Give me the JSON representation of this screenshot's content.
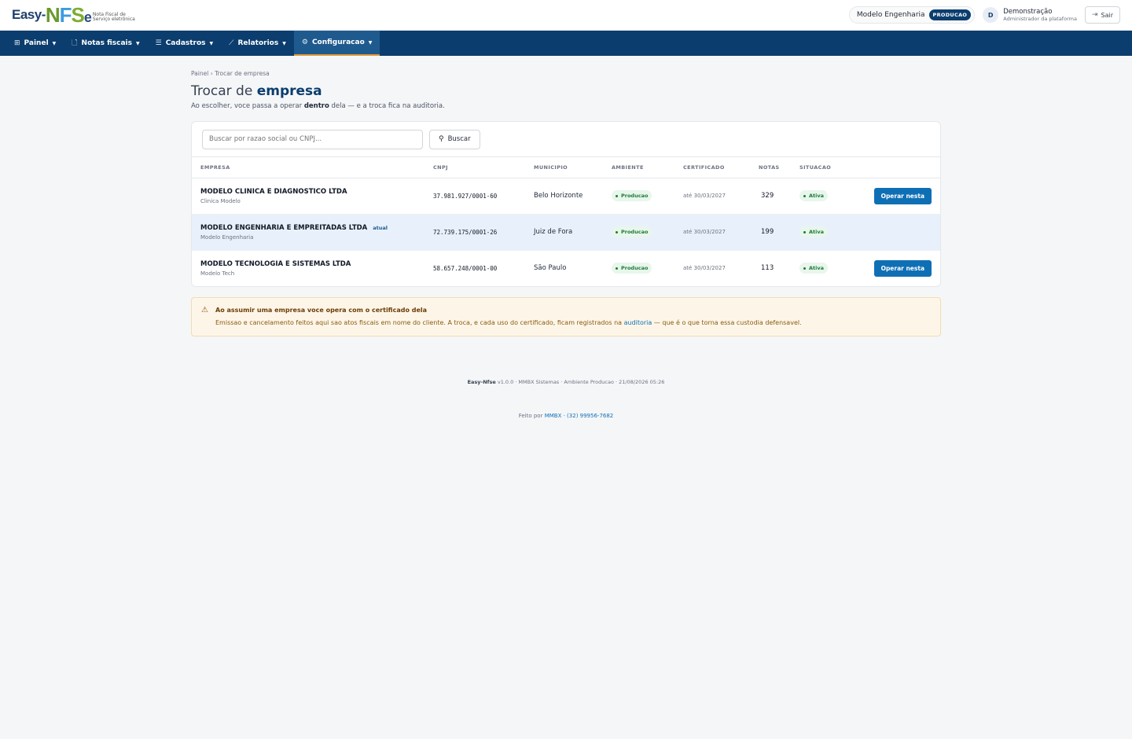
{
  "header": {
    "logo": {
      "easy": "Easy-",
      "n": "N",
      "f": "F",
      "s": "S",
      "e": "e",
      "subtitle": "Nota Fiscal de Serviço eletrônica"
    },
    "company": "Modelo Engenharia",
    "environment_badge": "PRODUCAO",
    "user_initial": "D",
    "user_name": "Demonstração",
    "user_role": "Administrador da plataforma",
    "logout_label": "Sair"
  },
  "nav": [
    {
      "label": "Painel",
      "icon": "dashboard-icon"
    },
    {
      "label": "Notas fiscais",
      "icon": "document-icon"
    },
    {
      "label": "Cadastros",
      "icon": "list-icon"
    },
    {
      "label": "Relatorios",
      "icon": "chart-icon"
    },
    {
      "label": "Configuracao",
      "icon": "gear-icon",
      "active": true
    }
  ],
  "breadcrumb": "Painel › Trocar de empresa",
  "title": {
    "prefix": "Trocar de ",
    "bold": "empresa"
  },
  "subtitle": {
    "pre": "Ao escolher, voce passa a operar ",
    "bold": "dentro",
    "post": " dela — e a troca fica na auditoria."
  },
  "search": {
    "placeholder": "Buscar por razao social ou CNPJ...",
    "button": "Buscar"
  },
  "table": {
    "columns": [
      "EMPRESA",
      "CNPJ",
      "MUNICIPIO",
      "AMBIENTE",
      "CERTIFICADO",
      "NOTAS",
      "SITUACAO"
    ],
    "rows": [
      {
        "name": "MODELO CLINICA E DIAGNOSTICO LTDA",
        "fantasy": "Clinica Modelo",
        "tag": "",
        "cnpj": "37.981.927/0001-60",
        "municipio": "Belo Horizonte",
        "ambiente": "Producao",
        "certificado": "até 30/03/2027",
        "notas": "329",
        "situacao": "Ativa",
        "action": "Operar nesta"
      },
      {
        "name": "MODELO ENGENHARIA E EMPREITADAS LTDA",
        "fantasy": "Modelo Engenharia",
        "tag": "atual",
        "cnpj": "72.739.175/0001-26",
        "municipio": "Juiz de Fora",
        "ambiente": "Producao",
        "certificado": "até 30/03/2027",
        "notas": "199",
        "situacao": "Ativa",
        "action": ""
      },
      {
        "name": "MODELO TECNOLOGIA E SISTEMAS LTDA",
        "fantasy": "Modelo Tech",
        "tag": "",
        "cnpj": "58.657.248/0001-00",
        "municipio": "São Paulo",
        "ambiente": "Producao",
        "certificado": "até 30/03/2027",
        "notas": "113",
        "situacao": "Ativa",
        "action": "Operar nesta"
      }
    ]
  },
  "alert": {
    "title": "Ao assumir uma empresa voce opera com o certificado dela",
    "body_pre": "Emissao e cancelamento feitos aqui sao atos fiscais em nome do cliente. A troca, e cada uso do certificado, ficam registrados na ",
    "link": "auditoria",
    "body_post": " — que é o que torna essa custodia defensavel."
  },
  "footer": {
    "brand": "Easy-Nfse",
    "info": " v1.0.0 · MMBX Sistemas · Ambiente Producao · 21/08/2026 05:26",
    "made_by": "Feito por ",
    "made_link": "MMBX · (32) 99956-7682"
  },
  "colors": {
    "primary": "#0b3d6e",
    "accent": "#e39a3a",
    "action": "#0f6fb5",
    "success": "#1e7a3a"
  }
}
